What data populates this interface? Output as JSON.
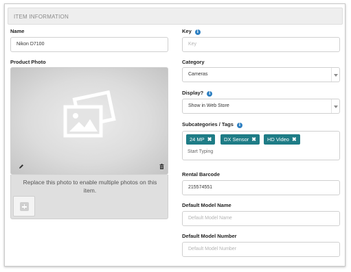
{
  "section": {
    "title": "ITEM INFORMATION"
  },
  "name_field": {
    "label": "Name",
    "value": "Nikon D7100"
  },
  "key_field": {
    "label": "Key",
    "placeholder": "Key"
  },
  "product_photo": {
    "label": "Product Photo",
    "replace_text": "Replace this photo to enable multiple photos on this item.",
    "icons": [
      "photo-icon",
      "pencil-icon",
      "trash-icon",
      "plus-icon"
    ]
  },
  "category": {
    "label": "Category",
    "value": "Cameras"
  },
  "display": {
    "label": "Display?",
    "value": "Show in Web Store"
  },
  "subcategories": {
    "label": "Subcategories / Tags",
    "tags": [
      {
        "label": "24 MP",
        "remove": "✖"
      },
      {
        "label": "DX Sensor",
        "remove": "✖"
      },
      {
        "label": "HD Video",
        "remove": "✖"
      }
    ],
    "input_placeholder": "Start Typing"
  },
  "rental_barcode": {
    "label": "Rental Barcode",
    "value": "215574551"
  },
  "default_model_name": {
    "label": "Default Model Name",
    "placeholder": "Default Model Name"
  },
  "default_model_number": {
    "label": "Default Model Number",
    "placeholder": "Default Model Number"
  },
  "info_glyph": "i",
  "colors": {
    "tag": "#1e7c86",
    "info": "#2d7fc1",
    "header_bg": "#eeeeee"
  }
}
